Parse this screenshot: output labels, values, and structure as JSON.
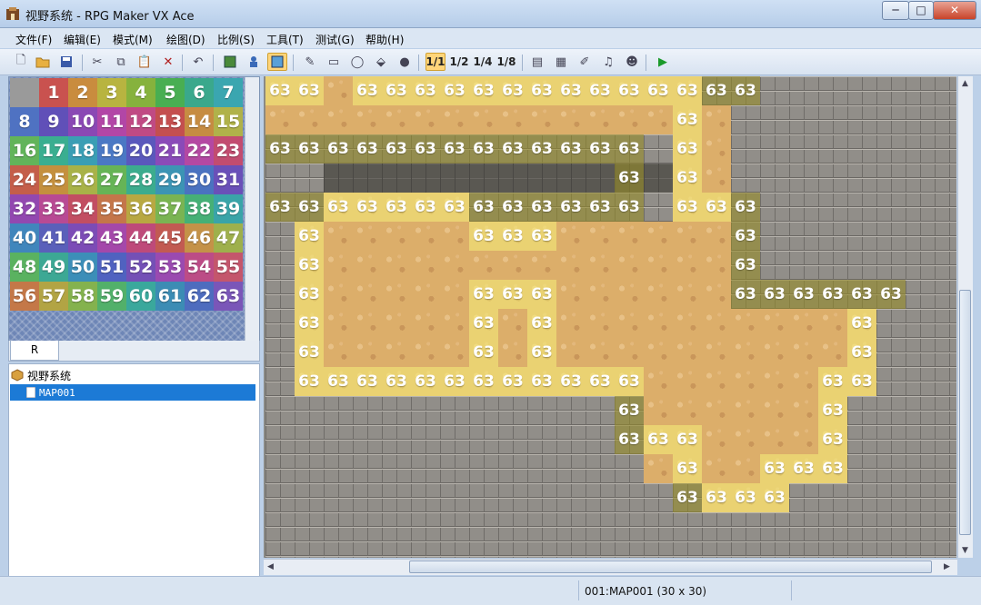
{
  "window": {
    "title": "视野系统 - RPG Maker VX Ace",
    "min": "─",
    "max": "□",
    "close": "✕"
  },
  "menu": [
    "文件(F)",
    "编辑(E)",
    "模式(M)",
    "绘图(D)",
    "比例(S)",
    "工具(T)",
    "测试(G)",
    "帮助(H)"
  ],
  "toolbar": {
    "scale_labels": [
      "1/1",
      "1/2",
      "1/4",
      "1/8"
    ],
    "selected": "1/1"
  },
  "palette": {
    "cells": [
      "",
      "1",
      "2",
      "3",
      "4",
      "5",
      "6",
      "7",
      "8",
      "9",
      "10",
      "11",
      "12",
      "13",
      "14",
      "15",
      "16",
      "17",
      "18",
      "19",
      "20",
      "21",
      "22",
      "23",
      "24",
      "25",
      "26",
      "27",
      "28",
      "29",
      "30",
      "31",
      "32",
      "33",
      "34",
      "35",
      "36",
      "37",
      "38",
      "39",
      "40",
      "41",
      "42",
      "43",
      "44",
      "45",
      "46",
      "47",
      "48",
      "49",
      "50",
      "51",
      "52",
      "53",
      "54",
      "55",
      "56",
      "57",
      "58",
      "59",
      "60",
      "61",
      "62",
      "63"
    ],
    "colors": [
      "#9a9a9a",
      "#c9524f",
      "#c98c3e",
      "#b8b440",
      "#86b23d",
      "#49ae52",
      "#3aa88c",
      "#3aa6b0",
      "#4f72c2",
      "#6050b8",
      "#8a48b4",
      "#b246a6",
      "#c04a84",
      "#c44f4f",
      "#c68c42",
      "#b0b24a",
      "#62b45a",
      "#3aae90",
      "#3a9eb4",
      "#4a78c4",
      "#5a58bc",
      "#8a4ab8",
      "#b448a2",
      "#c24c70",
      "#c45e4a",
      "#c4903e",
      "#a8b248",
      "#66b456",
      "#3cac8e",
      "#3c94b4",
      "#4a72c0",
      "#6a50b8",
      "#9248b0",
      "#b84a94",
      "#c24e62",
      "#c4764a",
      "#b8a842",
      "#7ab452",
      "#46b076",
      "#3aa4a8",
      "#4086bc",
      "#5a60ba",
      "#7c4cb6",
      "#a448aa",
      "#be4a7a",
      "#c25a52",
      "#c49248",
      "#9eb04c",
      "#5ab260",
      "#3ca894",
      "#3c8eb8",
      "#5062c0",
      "#7450b6",
      "#9a4ab0",
      "#bc4c86",
      "#c4566c",
      "#c47848",
      "#b2a444",
      "#84b24e",
      "#52b06a",
      "#3aa89c",
      "#3c8cb4",
      "#4e6cbe",
      "#7a56b8"
    ],
    "tab": "R"
  },
  "tree": {
    "root": "视野系统",
    "map": "MAP001"
  },
  "map": {
    "label": "63",
    "rows": [
      "OOOOOXXXXXXXXXXXXOOOOOOOOOOOOOO",
      "XXXXXXXXXXXXXXXOOXXOOOOOOOOOOOO",
      "OOOOOOOOOOOOOOOXXOOOOOOOOOOOOOO",
      "XXXXXXXXXXXXXXXXOXOOOOOOOOOOOOO",
      "OOOOOOOOOOOOOOOXXOOOOOOOOOOOOOO",
      "XXXXXXXXXXXXXXXXXXXXOOOOOOOOOOO"
    ],
    "marked_rows": [
      "0:0-1,3-16",
      "1:14",
      "2:0-12,14",
      "3:12,14",
      "4:0-12,14-16",
      "5:1,7-9,16",
      "6:1,16",
      "7:1,7-9,16-21",
      "8:1,7,9,20",
      "9:1,7,9,20",
      "10:1-8,9-12,19-20",
      "11:12,19",
      "12:12-14,19",
      "13:14,17-19",
      "14:14-17"
    ]
  },
  "status": {
    "map_info": "001:MAP001 (30 x 30)"
  }
}
